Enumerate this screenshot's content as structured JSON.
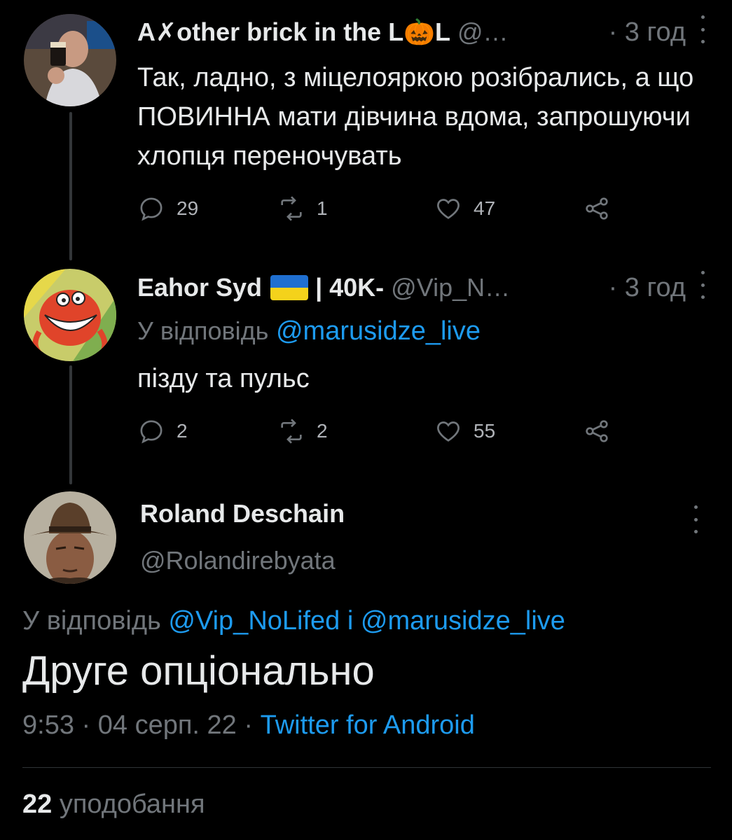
{
  "tweets": [
    {
      "name": "A✗other brick in the L🎃L",
      "handle": "@…",
      "time": "· 3 год",
      "text": "Так, ладно, з міцелояркою розібрались, а що ПОВИННА мати дівчина вдома, запрошуючи хлопця переночувать",
      "replies": "29",
      "retweets": "1",
      "likes": "47"
    },
    {
      "name": "Eahor Syd",
      "flag": "ukraine-flag",
      "name_suffix": "| 40K-",
      "handle": "@Vip_N…",
      "time": "· 3 год",
      "reply_label": "У відповідь",
      "reply_mention": "@marusidze_live",
      "text": "пізду та пульс",
      "replies": "2",
      "retweets": "2",
      "likes": "55"
    }
  ],
  "main": {
    "name": "Roland Deschain",
    "handle": "@Rolandirebyata",
    "reply_label": "У відповідь",
    "reply_mention_1": "@Vip_NoLifed",
    "reply_join": "і",
    "reply_mention_2": "@marusidze_live",
    "text": "Друге опціонально",
    "time": "9:53",
    "sep": "·",
    "date": "04 серп. 22",
    "client": "Twitter for Android",
    "likes_count": "22",
    "likes_label": "уподобання"
  },
  "colors": {
    "background": "#000000",
    "text": "#e7e9ea",
    "secondary": "#71767b",
    "link": "#1d9bf0"
  },
  "icons": [
    "reply-icon",
    "retweet-icon",
    "like-icon",
    "share-icon",
    "more-icon"
  ]
}
